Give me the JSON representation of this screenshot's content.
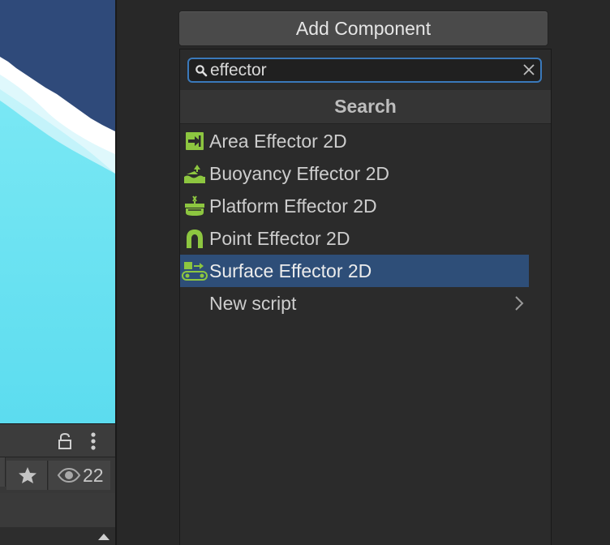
{
  "colors": {
    "scene_sky": "#2f4a7a",
    "scene_water": "#62dff0",
    "accent_selection": "#2e4e78",
    "search_focus": "#3a79bb",
    "icon_green": "#8dc640"
  },
  "toolbar": {
    "lock_icon": "lock-icon",
    "more_icon": "kebab-menu-icon",
    "favorite_icon": "star-icon",
    "visibility_icon": "eye-icon",
    "visibility_count": "22"
  },
  "inspector": {
    "add_component_label": "Add Component"
  },
  "component_picker": {
    "search": {
      "value": "effector",
      "placeholder": ""
    },
    "header": "Search",
    "items": [
      {
        "label": "Area Effector 2D",
        "icon": "area-effector-icon",
        "selected": false
      },
      {
        "label": "Buoyancy Effector 2D",
        "icon": "buoyancy-effector-icon",
        "selected": false
      },
      {
        "label": "Platform Effector 2D",
        "icon": "platform-effector-icon",
        "selected": false
      },
      {
        "label": "Point Effector 2D",
        "icon": "point-effector-icon",
        "selected": false
      },
      {
        "label": "Surface Effector 2D",
        "icon": "surface-effector-icon",
        "selected": true
      },
      {
        "label": "New script",
        "icon": "",
        "selected": false,
        "submenu": true
      }
    ]
  }
}
